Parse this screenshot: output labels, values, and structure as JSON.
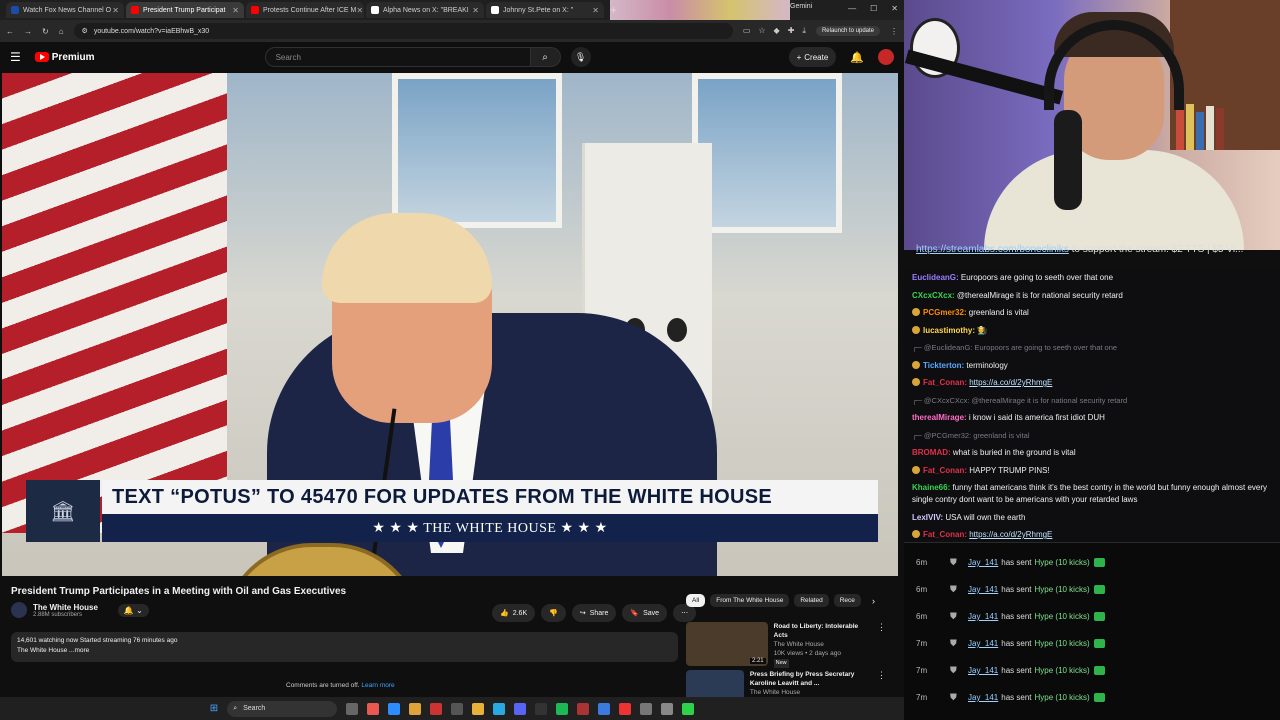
{
  "browser": {
    "tabs": [
      {
        "label": "Watch Fox News Channel O",
        "color": "#1e4aa8"
      },
      {
        "label": "President Trump Participat",
        "color": "#ff0000",
        "active": true
      },
      {
        "label": "Protests Continue After ICE M",
        "color": "#ff0000"
      },
      {
        "label": "Alpha News on X: \"BREAKI",
        "color": "#ffffff"
      },
      {
        "label": "Johnny St.Pete on X: \"",
        "color": "#ffffff"
      }
    ],
    "profile_label": "Gemini",
    "url": "youtube.com/watch?v=iaEBhwB_x30",
    "relaunch": "Relaunch to update"
  },
  "youtube": {
    "logo": "Premium",
    "search_placeholder": "Search",
    "create_label": "Create",
    "video": {
      "lower_third_line1": "TEXT “POTUS” TO 45470 FOR UPDATES FROM THE WHITE HOUSE",
      "lower_third_line2": "★ ★ ★   THE WHITE HOUSE   ★ ★ ★"
    },
    "title": "President Trump Participates in a Meeting with Oil and Gas Executives",
    "channel": {
      "name": "The White House",
      "subs": "2.88M subscribers"
    },
    "actions": {
      "likes": "2.6K",
      "share": "Share",
      "save": "Save"
    },
    "description": {
      "line1": "14,601 watching now  Started streaming 76 minutes ago",
      "line2": "The White House ...more"
    },
    "comments": {
      "text": "Comments are turned off.",
      "link": "Learn more"
    },
    "chips": [
      "All",
      "From The White House",
      "Related",
      "Rece"
    ],
    "recommendations": [
      {
        "title": "Road to Liberty: Intolerable Acts",
        "channel": "The White House",
        "meta": "10K views • 2 days ago",
        "badge": "New",
        "duration": "2:21",
        "color": "#4a3b2a"
      },
      {
        "title": "Press Briefing by Press Secretary Karoline Leavitt and ...",
        "channel": "The White House",
        "meta": "",
        "badge": "",
        "duration": "",
        "color": "#2b3a55"
      }
    ]
  },
  "taskbar": {
    "search": "Search"
  },
  "stream": {
    "ticker_link": "https://streamlabs.com/bonecliniks",
    "ticker_text": " to support the stream! $2 TTS | $5 Vi..."
  },
  "chat": [
    {
      "user": "EuclideanG:",
      "color": "#9b7dff",
      "text": " Europoors are going to seeth over that one"
    },
    {
      "user": "CXcxCXcx:",
      "color": "#39d353",
      "text": " @therealMirage it is for national security retard"
    },
    {
      "user": "PCGmer32:",
      "color": "#ff8c00",
      "text": " greenland is vital",
      "badge": true
    },
    {
      "user": "lucastimothy:",
      "color": "#ffd84d",
      "text": " 🧑‍🌾",
      "badge": true
    },
    {
      "reply": "@EuclideanG: Europoors are going to seeth over that one"
    },
    {
      "user": "Tickterton:",
      "color": "#5aa9ff",
      "text": "       terminology",
      "badge": true
    },
    {
      "user": "Fat_Conan:",
      "color": "#e0304a",
      "text": " ",
      "link": "https://a.co/d/2yRhmgE",
      "badge": true
    },
    {
      "reply": "@CXcxCXcx: @therealMirage it is for national security retard"
    },
    {
      "user": "therealMirage:",
      "color": "#ff6ec7",
      "text": " i know i said its america first idiot DUH"
    },
    {
      "reply": "@PCGmer32: greenland is vital"
    },
    {
      "user": "BROMAD:",
      "color": "#e0304a",
      "text": " what is buried in the ground is vital"
    },
    {
      "user": "Fat_Conan:",
      "color": "#e0304a",
      "text": " HAPPY TRUMP PINS!",
      "badge": true
    },
    {
      "user": "Khaine66:",
      "color": "#39d353",
      "text": " funny that americans think it's the best contry in the world but funny enough almost every single contry dont want to be americans with your retarded laws",
      "wrap": true
    },
    {
      "user": "LexIVIV:",
      "color": "#d4c7ff",
      "text": " USA will own the earth"
    },
    {
      "user": "Fat_Conan:",
      "color": "#e0304a",
      "text": " ",
      "link": "https://a.co/d/2yRhmgE",
      "badge": true
    }
  ],
  "events": [
    {
      "time": "6m",
      "user": "Jay_141",
      "action": "has sent",
      "amount": "Hype (10 kicks)"
    },
    {
      "time": "6m",
      "user": "Jay_141",
      "action": "has sent",
      "amount": "Hype (10 kicks)"
    },
    {
      "time": "6m",
      "user": "Jay_141",
      "action": "has sent",
      "amount": "Hype (10 kicks)"
    },
    {
      "time": "7m",
      "user": "Jay_141",
      "action": "has sent",
      "amount": "Hype (10 kicks)"
    },
    {
      "time": "7m",
      "user": "Jay_141",
      "action": "has sent",
      "amount": "Hype (10 kicks)"
    },
    {
      "time": "7m",
      "user": "Jay_141",
      "action": "has sent",
      "amount": "Hype (10 kicks)"
    },
    {
      "time": "7m",
      "user": "Jay_141",
      "action": "has sent",
      "amount": "Hype (10 kicks)"
    }
  ]
}
